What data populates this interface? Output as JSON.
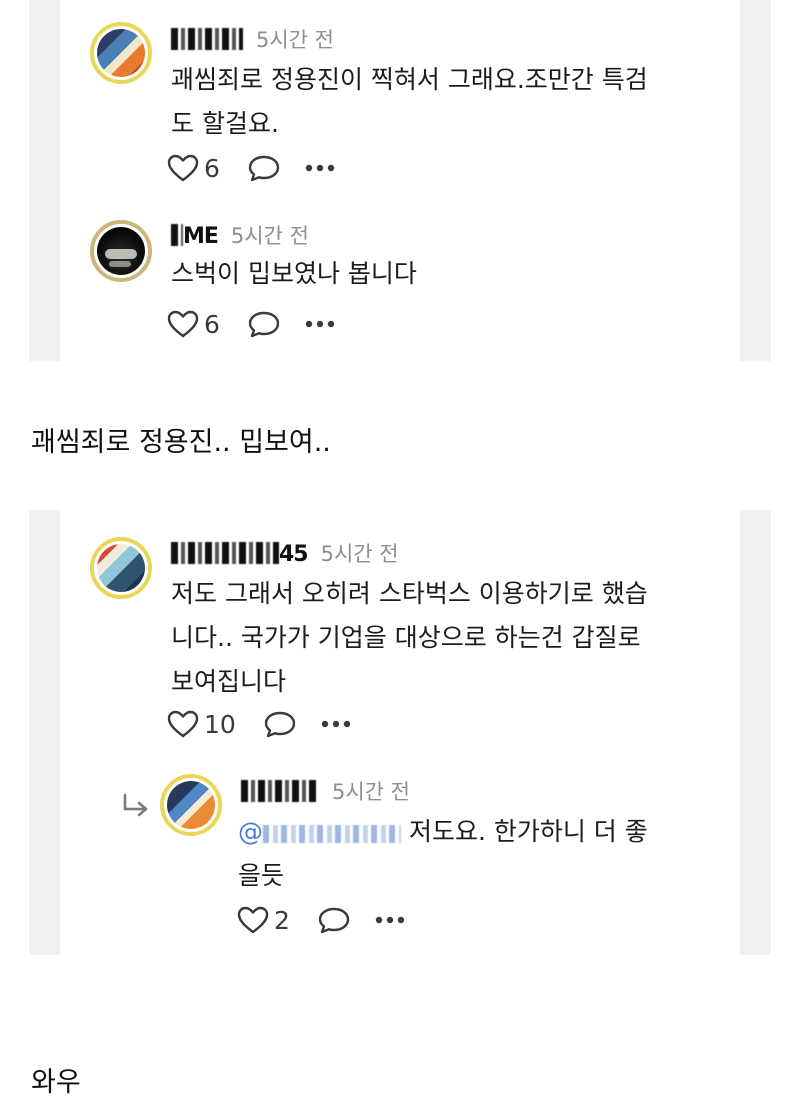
{
  "shot1": {
    "comment1": {
      "author_visible": "",
      "time": "5시간 전",
      "text_line1": "괘씸죄로 정용진이 찍혀서 그래요.조만간 특검",
      "text_line2": "도 할걸요.",
      "likes": "6"
    },
    "comment2": {
      "author_visible": "ME",
      "time": "5시간 전",
      "text": "스벅이 밉보였나 봅니다",
      "likes": "6"
    }
  },
  "body_text1": "괘씸죄로 정용진.. 밉보여..",
  "shot2": {
    "comment1": {
      "author_suffix": "45",
      "time": "5시간 전",
      "text_line1": "저도 그래서 오히려 스타벅스 이용하기로 했습",
      "text_line2": "니다.. 국가가 기업을 대상으로 하는건 갑질로",
      "text_line3": "보여집니다",
      "likes": "10"
    },
    "reply": {
      "time": "5시간 전",
      "mention_prefix": "@",
      "text_after_mention": "저도요. 한가하니 더 좋",
      "text_line2": "을듯",
      "likes": "2"
    }
  },
  "body_text2": "와우",
  "icons": [
    "heart-outline-icon",
    "comment-bubble-icon",
    "more-dots-icon",
    "reply-arrow-icon"
  ],
  "colors": {
    "avatar_border": "#e9d75a",
    "mention": "#4a7fd6",
    "time": "#8e8e93",
    "panel_bg": "#f1f1f3"
  }
}
